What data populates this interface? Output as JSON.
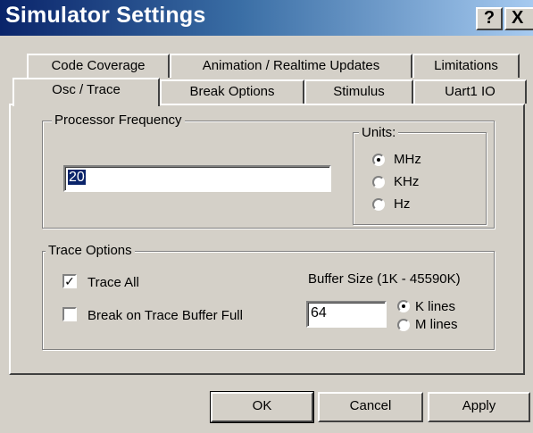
{
  "window": {
    "title": "Simulator Settings",
    "help_glyph": "?",
    "close_glyph": "X"
  },
  "tabs": {
    "row_back": [
      "Code Coverage",
      "Animation / Realtime  Updates",
      "Limitations"
    ],
    "row_front": [
      "Osc / Trace",
      "Break Options",
      "Stimulus",
      "Uart1  IO"
    ],
    "active": "Osc / Trace"
  },
  "processor": {
    "group_label": "Processor  Frequency",
    "frequency_value": "20",
    "units_label": "Units:",
    "units_options": [
      "MHz",
      "KHz",
      "Hz"
    ],
    "units_selected": "MHz"
  },
  "trace": {
    "group_label": "Trace Options",
    "trace_all_label": "Trace All",
    "trace_all_checked": true,
    "break_full_label": "Break on Trace Buffer Full",
    "break_full_checked": false,
    "buffer_label": "Buffer Size  (1K - 45590K)",
    "buffer_value": "64",
    "lines_options": [
      "K lines",
      "M lines"
    ],
    "lines_selected": "K lines"
  },
  "buttons": {
    "ok": "OK",
    "cancel": "Cancel",
    "apply": "Apply"
  },
  "colors": {
    "titlebar_start": "#0a246a",
    "titlebar_end": "#a6caf0",
    "face": "#d4d0c8"
  }
}
